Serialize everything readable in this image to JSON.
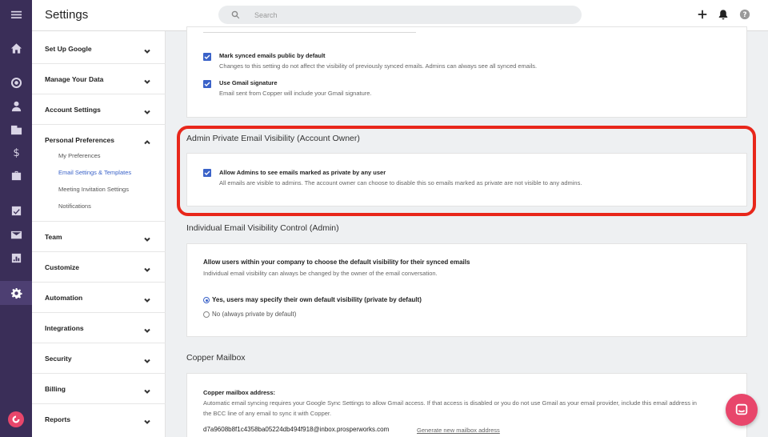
{
  "app": {
    "title": "Settings"
  },
  "search": {
    "placeholder": "Search"
  },
  "sidebar": {
    "sections": [
      {
        "label": "Set Up Google"
      },
      {
        "label": "Manage Your Data"
      },
      {
        "label": "Account Settings"
      },
      {
        "label": "Personal Preferences"
      },
      {
        "label": "Team"
      },
      {
        "label": "Customize"
      },
      {
        "label": "Automation"
      },
      {
        "label": "Integrations"
      },
      {
        "label": "Security"
      },
      {
        "label": "Billing"
      },
      {
        "label": "Reports"
      }
    ],
    "personal_items": [
      {
        "label": "My Preferences"
      },
      {
        "label": "Email Settings & Templates"
      },
      {
        "label": "Meeting Invitation Settings"
      },
      {
        "label": "Notifications"
      }
    ]
  },
  "sync_card": {
    "opt1_label": "Mark synced emails public by default",
    "opt1_desc": "Changes to this setting do not affect the visibility of previously synced emails. Admins can always see all synced emails.",
    "opt2_label": "Use Gmail signature",
    "opt2_desc": "Email sent from Copper will include your Gmail signature."
  },
  "admin_private": {
    "title": "Admin Private Email Visibility (Account Owner)",
    "opt_label": "Allow Admins to see emails marked as private by any user",
    "opt_desc": "All emails are visible to admins. The account owner can choose to disable this so emails marked as private are not visible to any admins."
  },
  "individual": {
    "title": "Individual Email Visibility Control (Admin)",
    "heading": "Allow users within your company to choose the default visibility for their synced emails",
    "desc": "Individual email visibility can always be changed by the owner of the email conversation.",
    "radio1": "Yes, users may specify their own default visibility (private by default)",
    "radio2": "No (always private by default)"
  },
  "mailbox": {
    "title": "Copper Mailbox",
    "heading": "Copper mailbox address:",
    "desc1": "Automatic email syncing requires your Google Sync Settings to allow Gmail access. If that access is disabled or you do not use Gmail as your email provider, include this email address in",
    "desc2": "the BCC line of any email to sync it with Copper.",
    "address": "d7a9608b8f1c4358ba05224db494f918@inbox.prosperworks.com",
    "generate_link": "Generate new mailbox address"
  },
  "colors": {
    "accent": "#3a62c8",
    "rail": "#3a2e58",
    "highlight": "#e8271b",
    "brand": "#e8466b"
  }
}
